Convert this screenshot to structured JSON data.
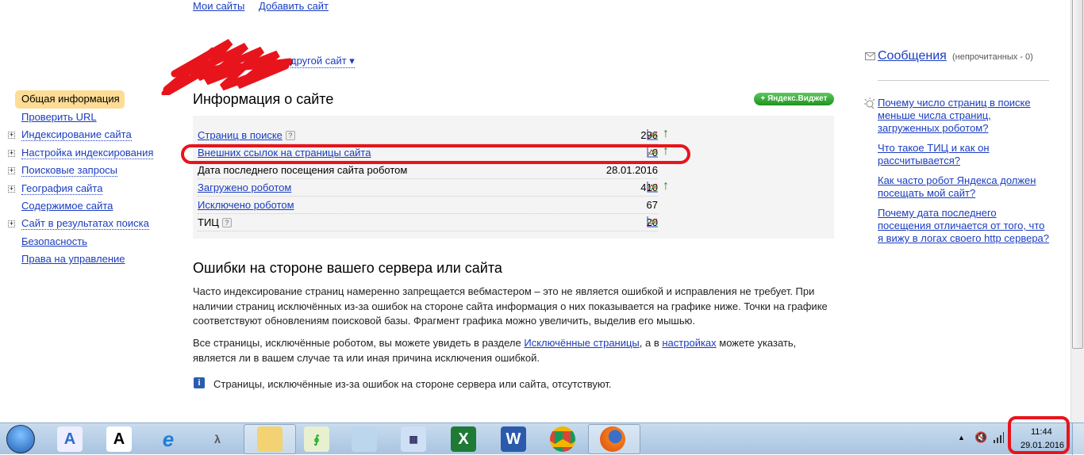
{
  "top_nav": {
    "my_sites": "Мои сайты",
    "add_site": "Добавить сайт"
  },
  "site_switch": "другой сайт ▾",
  "sidebar": {
    "items": [
      {
        "label": "Общая информация",
        "active": true,
        "expandable": false
      },
      {
        "label": "Проверить URL",
        "expandable": false
      },
      {
        "label": "Индексирование сайта",
        "expandable": true
      },
      {
        "label": "Настройка индексирования",
        "expandable": true
      },
      {
        "label": "Поисковые запросы",
        "expandable": true
      },
      {
        "label": "География сайта",
        "expandable": true
      },
      {
        "label": "Содержимое сайта",
        "expandable": false
      },
      {
        "label": "Сайт в результатах поиска",
        "expandable": true
      },
      {
        "label": "Безопасность",
        "expandable": false
      },
      {
        "label": "Права на управление",
        "expandable": false
      }
    ]
  },
  "info": {
    "title": "Информация о сайте",
    "widget_button": "+ Яндекс.Виджет",
    "rows": [
      {
        "label": "Страниц в поиске",
        "value": "296",
        "help": "?",
        "chart": true,
        "trend": "↑"
      },
      {
        "label": "Внешних ссылок на страницы сайта",
        "value": "0",
        "chart": true,
        "trend": "↑"
      },
      {
        "label": "Дата последнего посещения сайта роботом",
        "value": "28.01.2016"
      },
      {
        "label": "Загружено роботом",
        "value": "410",
        "chart": true,
        "trend": "↑"
      },
      {
        "label": "Исключено роботом",
        "value": "67"
      },
      {
        "label": "ТИЦ",
        "value": "20",
        "help": "?",
        "chart": true
      }
    ]
  },
  "errors": {
    "title": "Ошибки на стороне вашего сервера или сайта",
    "p1": "Часто индексирование страниц намеренно запрещается вебмастером – это не является ошибкой и исправления не требует. При наличии страниц исключённых из-за ошибок на стороне сайта информация о них показывается на графике ниже. Точки на графике соответствуют обновлениям поисковой базы. Фрагмент графика можно увеличить, выделив его мышью.",
    "p2_a": "Все страницы, исключённые роботом, вы можете увидеть в разделе ",
    "p2_link1": "Исключённые страницы",
    "p2_b": ", а в ",
    "p2_link2": "настройках",
    "p2_c": " можете указать, является ли в вашем случае та или иная причина исключения ошибкой.",
    "notice": "Страницы, исключённые из-за ошибок на стороне сервера или сайта, отсутствуют.",
    "notice_icon": "i"
  },
  "right": {
    "messages": "Сообщения",
    "unread": "(непрочитанных - 0)",
    "faq": [
      "Почему число страниц в поиске меньше числа страниц, загруженных роботом?",
      "Что такое ТИЦ и как он рассчитывается?",
      "Как часто робот Яндекса должен посещать мой сайт?",
      "Почему дата последнего посещения отличается от того, что я вижу в логах своего http сервера?"
    ]
  },
  "taskbar": {
    "time": "11:44",
    "date": "29.01.2016"
  },
  "colors": {
    "link": "#1a3dc1",
    "active_bg": "#fddc95",
    "annotation": "#e8141c",
    "widget": "#2fa52f"
  }
}
